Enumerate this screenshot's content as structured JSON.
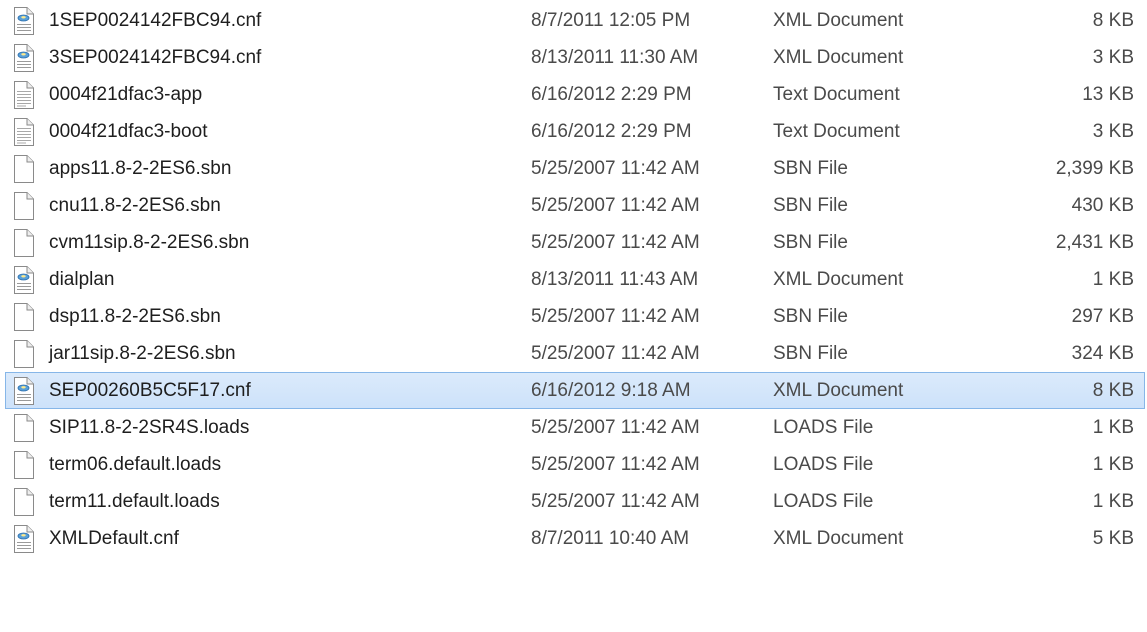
{
  "files": [
    {
      "name": "1SEP0024142FBC94.cnf",
      "date": "8/7/2011 12:05 PM",
      "type": "XML Document",
      "size": "8 KB",
      "icon": "xml-document-icon",
      "selected": false
    },
    {
      "name": "3SEP0024142FBC94.cnf",
      "date": "8/13/2011 11:30 AM",
      "type": "XML Document",
      "size": "3 KB",
      "icon": "xml-document-icon",
      "selected": false
    },
    {
      "name": "0004f21dfac3-app",
      "date": "6/16/2012 2:29 PM",
      "type": "Text Document",
      "size": "13 KB",
      "icon": "text-document-icon",
      "selected": false
    },
    {
      "name": "0004f21dfac3-boot",
      "date": "6/16/2012 2:29 PM",
      "type": "Text Document",
      "size": "3 KB",
      "icon": "text-document-icon",
      "selected": false
    },
    {
      "name": "apps11.8-2-2ES6.sbn",
      "date": "5/25/2007 11:42 AM",
      "type": "SBN File",
      "size": "2,399 KB",
      "icon": "blank-file-icon",
      "selected": false
    },
    {
      "name": "cnu11.8-2-2ES6.sbn",
      "date": "5/25/2007 11:42 AM",
      "type": "SBN File",
      "size": "430 KB",
      "icon": "blank-file-icon",
      "selected": false
    },
    {
      "name": "cvm11sip.8-2-2ES6.sbn",
      "date": "5/25/2007 11:42 AM",
      "type": "SBN File",
      "size": "2,431 KB",
      "icon": "blank-file-icon",
      "selected": false
    },
    {
      "name": "dialplan",
      "date": "8/13/2011 11:43 AM",
      "type": "XML Document",
      "size": "1 KB",
      "icon": "xml-document-icon",
      "selected": false
    },
    {
      "name": "dsp11.8-2-2ES6.sbn",
      "date": "5/25/2007 11:42 AM",
      "type": "SBN File",
      "size": "297 KB",
      "icon": "blank-file-icon",
      "selected": false
    },
    {
      "name": "jar11sip.8-2-2ES6.sbn",
      "date": "5/25/2007 11:42 AM",
      "type": "SBN File",
      "size": "324 KB",
      "icon": "blank-file-icon",
      "selected": false
    },
    {
      "name": "SEP00260B5C5F17.cnf",
      "date": "6/16/2012 9:18 AM",
      "type": "XML Document",
      "size": "8 KB",
      "icon": "xml-document-icon",
      "selected": true
    },
    {
      "name": "SIP11.8-2-2SR4S.loads",
      "date": "5/25/2007 11:42 AM",
      "type": "LOADS File",
      "size": "1 KB",
      "icon": "blank-file-icon",
      "selected": false
    },
    {
      "name": "term06.default.loads",
      "date": "5/25/2007 11:42 AM",
      "type": "LOADS File",
      "size": "1 KB",
      "icon": "blank-file-icon",
      "selected": false
    },
    {
      "name": "term11.default.loads",
      "date": "5/25/2007 11:42 AM",
      "type": "LOADS File",
      "size": "1 KB",
      "icon": "blank-file-icon",
      "selected": false
    },
    {
      "name": "XMLDefault.cnf",
      "date": "8/7/2011 10:40 AM",
      "type": "XML Document",
      "size": "5 KB",
      "icon": "xml-document-icon",
      "selected": false
    }
  ],
  "colors": {
    "selection_fill": "#d5e6fa",
    "selection_border": "#86b6e8",
    "text": "#1e1e1e",
    "detail_text": "#4a4a4a"
  }
}
